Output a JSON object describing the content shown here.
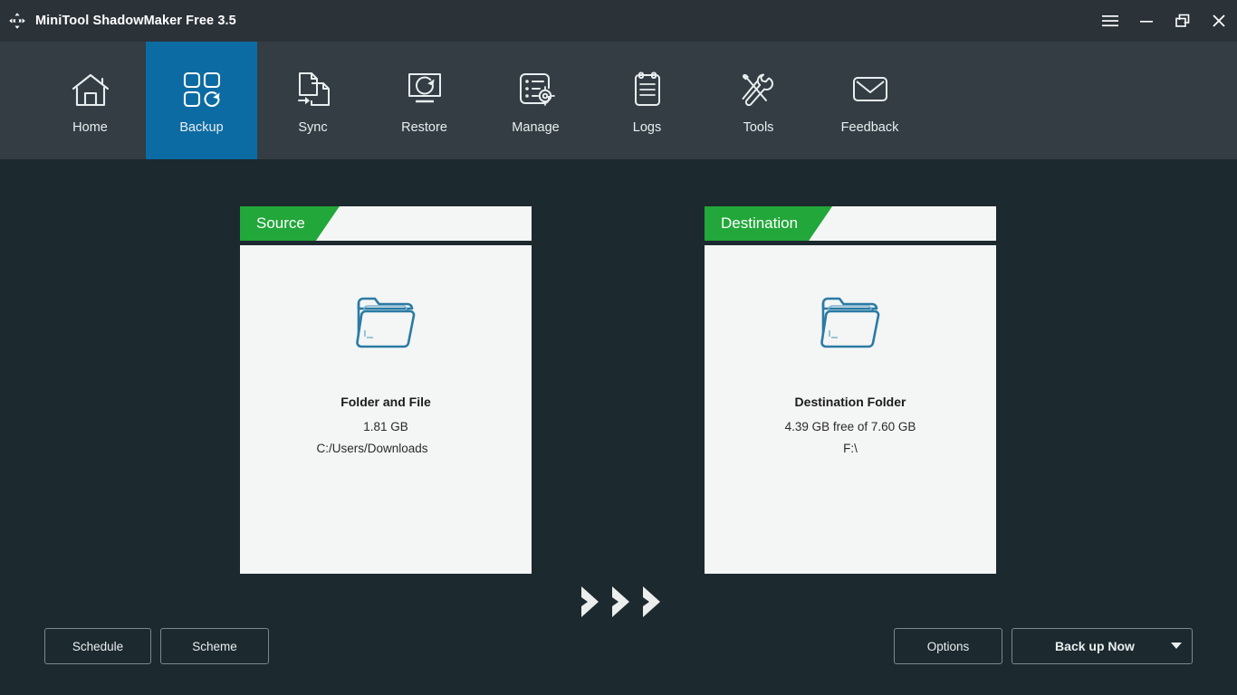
{
  "window": {
    "title": "MiniTool ShadowMaker Free 3.5",
    "app_icon": "move-sync-icon",
    "controls": {
      "menu": "menu-icon",
      "minimize": "minimize-icon",
      "restore": "restore-icon",
      "close": "close-icon"
    }
  },
  "nav": {
    "active": "Backup",
    "active_color": "#0d6ba3",
    "items": [
      {
        "label": "Home",
        "icon": "home-icon"
      },
      {
        "label": "Backup",
        "icon": "backup-grid-icon"
      },
      {
        "label": "Sync",
        "icon": "sync-files-icon"
      },
      {
        "label": "Restore",
        "icon": "restore-monitor-icon"
      },
      {
        "label": "Manage",
        "icon": "manage-list-gear-icon"
      },
      {
        "label": "Logs",
        "icon": "logs-clipboard-icon"
      },
      {
        "label": "Tools",
        "icon": "tools-wrench-screwdriver-icon"
      },
      {
        "label": "Feedback",
        "icon": "feedback-envelope-icon"
      }
    ]
  },
  "panels": {
    "tab_color": "#22a73a",
    "source": {
      "tab_label": "Source",
      "icon": "folder-icon",
      "title": "Folder and File",
      "size": "1.81 GB",
      "path": "C:/Users/Downloads"
    },
    "destination": {
      "tab_label": "Destination",
      "icon": "folder-icon",
      "title": "Destination Folder",
      "size": "4.39 GB free of 7.60 GB",
      "path": "F:\\"
    },
    "arrows_icon": "chevron-right-triple-icon"
  },
  "footer": {
    "schedule_label": "Schedule",
    "scheme_label": "Scheme",
    "options_label": "Options",
    "backup_label": "Back up Now",
    "backup_caret_icon": "caret-down-icon"
  }
}
